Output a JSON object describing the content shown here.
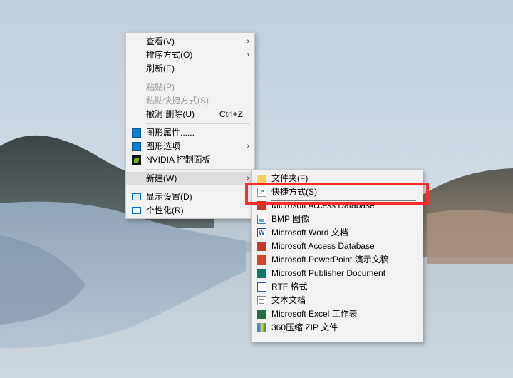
{
  "main_menu": {
    "items": [
      {
        "label": "查看(V)"
      },
      {
        "label": "排序方式(O)"
      },
      {
        "label": "刷新(E)"
      },
      {
        "label": "粘贴(P)"
      },
      {
        "label": "粘贴快捷方式(S)"
      },
      {
        "label": "撤消 删除(U)",
        "accelerator": "Ctrl+Z"
      },
      {
        "label": "图形属性......",
        "icon": "graphics-properties-icon"
      },
      {
        "label": "图形选项",
        "icon": "graphics-options-icon"
      },
      {
        "label": "NVIDIA 控制面板",
        "icon": "nvidia-icon"
      },
      {
        "label": "新建(W)"
      },
      {
        "label": "显示设置(D)",
        "icon": "display-icon"
      },
      {
        "label": "个性化(R)",
        "icon": "personalize-icon"
      }
    ],
    "submenu_arrow": "›"
  },
  "new_submenu": {
    "items": [
      {
        "label": "文件夹(F)",
        "icon": "folder-icon"
      },
      {
        "label": "快捷方式(S)",
        "icon": "shortcut-icon"
      },
      {
        "label": "Microsoft Access Database",
        "icon": "access-icon"
      },
      {
        "label": "BMP 图像",
        "icon": "bmp-icon"
      },
      {
        "label": "Microsoft Word 文档",
        "icon": "word-icon"
      },
      {
        "label": "Microsoft Access Database",
        "icon": "access-icon"
      },
      {
        "label": "Microsoft PowerPoint 演示文稿",
        "icon": "powerpoint-icon"
      },
      {
        "label": "Microsoft Publisher Document",
        "icon": "publisher-icon"
      },
      {
        "label": "RTF 格式",
        "icon": "rtf-icon"
      },
      {
        "label": "文本文档",
        "icon": "text-document-icon"
      },
      {
        "label": "Microsoft Excel 工作表",
        "icon": "excel-icon"
      },
      {
        "label": "360压缩 ZIP 文件",
        "icon": "zip-icon"
      }
    ]
  },
  "colors": {
    "highlight_box": "#ff2b2b",
    "menu_background": "#f2f2f2",
    "disabled_text": "#9a9a9a"
  }
}
